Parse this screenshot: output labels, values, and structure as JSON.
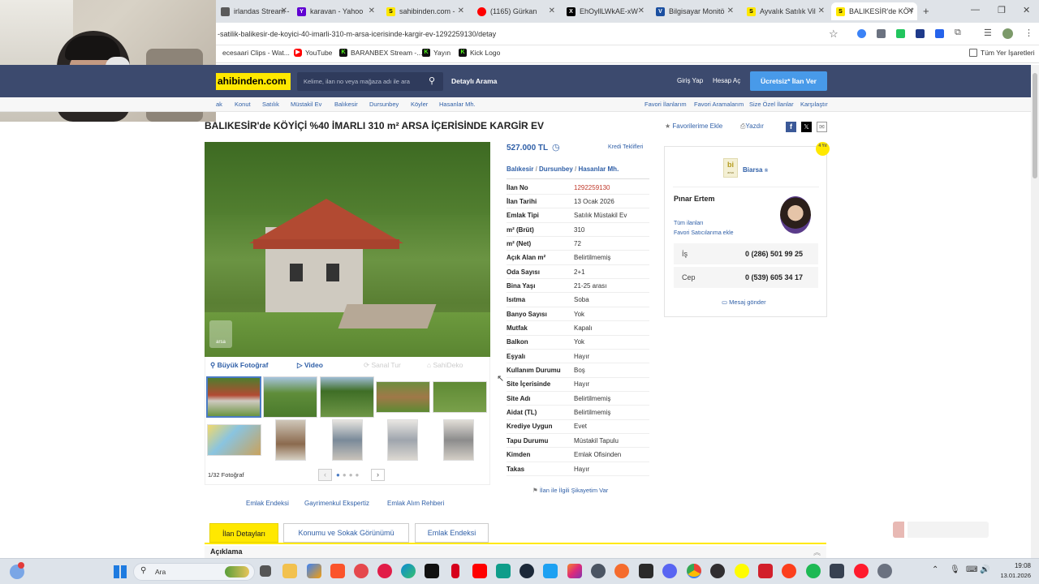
{
  "browser": {
    "tabs": [
      {
        "title": "irlandas Stream -",
        "fav_color": "#5a5a5a"
      },
      {
        "title": "karavan - Yahoo",
        "fav_color": "#6001d2",
        "fav": "Y"
      },
      {
        "title": "sahibinden.com -",
        "fav_color": "#ffe800",
        "fav": "S"
      },
      {
        "title": "(1165) Gürkan",
        "fav_color": "#ff0000"
      },
      {
        "title": "EhOyllLWkAE-xW",
        "fav_color": "#000000",
        "fav": "X"
      },
      {
        "title": "Bilgisayar Monitö",
        "fav_color": "#1b4fa0",
        "fav": "V"
      },
      {
        "title": "Ayvalık Satılık Vil",
        "fav_color": "#ffe800",
        "fav": "S"
      },
      {
        "title": "BALIKESİR'de KÖY",
        "fav_color": "#ffe800",
        "fav": "S"
      }
    ],
    "url": "-satilik-balikesir-de-koyici-40-imarli-310-m-arsa-icerisinde-kargir-ev-1292259130/detay",
    "bookmarks": [
      {
        "label": "ecesaari Clips - Wat..."
      },
      {
        "label": "YouTube"
      },
      {
        "label": "BARANBEX Stream -..."
      },
      {
        "label": "Yayın"
      },
      {
        "label": "Kick Logo"
      }
    ],
    "all_bookmarks": "Tüm Yer İşaretleri"
  },
  "site": {
    "logo": "ahibinden.com",
    "search_placeholder": "Kelime, ilan no veya mağaza adı ile ara",
    "detailed_search": "Detaylı Arama",
    "login": "Giriş Yap",
    "register": "Hesap Aç",
    "post_ad": "Ücretsiz* İlan Ver",
    "breadcrumbs": [
      "ak",
      "Konut",
      "Satılık",
      "Müstakil Ev",
      "Balıkesir",
      "Dursunbey",
      "Köyler",
      "Hasanlar Mh."
    ],
    "right_links": [
      "Favori İlanlarım",
      "Favori Aramalarım",
      "Size Özel İlanlar",
      "Karşılaştır"
    ]
  },
  "listing": {
    "title": "BALIKESİR'de KÖYİÇİ %40 İMARLI 310 m² ARSA İÇERİSİNDE KARGİR EV",
    "favorite": "Favorilerime Ekle",
    "print": "Yazdır",
    "price": "527.000 TL",
    "loan_offers": "Kredi Teklifleri",
    "location": [
      "Balıkesir",
      "Dursunbey",
      "Hasanlar Mh."
    ],
    "photo_watermark": "arsa",
    "media": {
      "big_photo": "Büyük Fotoğraf",
      "video": "Video",
      "virtual_tour": "Sanal Tur",
      "sahibeko": "SahiDeko"
    },
    "photo_counter": "1/32 Fotoğraf",
    "attributes": [
      {
        "k": "İlan No",
        "v": "1292259130",
        "red": true
      },
      {
        "k": "İlan Tarihi",
        "v": "13 Ocak 2026"
      },
      {
        "k": "Emlak Tipi",
        "v": "Satılık Müstakil Ev"
      },
      {
        "k": "m² (Brüt)",
        "v": "310"
      },
      {
        "k": "m² (Net)",
        "v": "72"
      },
      {
        "k": "Açık Alan m²",
        "v": "Belirtilmemiş"
      },
      {
        "k": "Oda Sayısı",
        "v": "2+1"
      },
      {
        "k": "Bina Yaşı",
        "v": "21-25 arası"
      },
      {
        "k": "Isıtma",
        "v": "Soba"
      },
      {
        "k": "Banyo Sayısı",
        "v": "Yok"
      },
      {
        "k": "Mutfak",
        "v": "Kapalı"
      },
      {
        "k": "Balkon",
        "v": "Yok"
      },
      {
        "k": "Eşyalı",
        "v": "Hayır"
      },
      {
        "k": "Kullanım Durumu",
        "v": "Boş"
      },
      {
        "k": "Site İçerisinde",
        "v": "Hayır"
      },
      {
        "k": "Site Adı",
        "v": "Belirtilmemiş"
      },
      {
        "k": "Aidat (TL)",
        "v": "Belirtilmemiş"
      },
      {
        "k": "Krediye Uygun",
        "v": "Evet"
      },
      {
        "k": "Tapu Durumu",
        "v": "Müstakil Tapulu"
      },
      {
        "k": "Kimden",
        "v": "Emlak Ofisinden"
      },
      {
        "k": "Takas",
        "v": "Hayır"
      }
    ],
    "complaint": "İlan ile İlgili Şikayetim Var",
    "links": [
      "Emlak Endeksi",
      "Gayrimenkul Ekspertiz",
      "Emlak Alım Rehberi"
    ],
    "tabs": [
      "İlan Detayları",
      "Konumu ve Sokak Görünümü",
      "Emlak Endeksi"
    ],
    "section": "Açıklama"
  },
  "seller": {
    "store": "Biarsa",
    "store_logo": "bi",
    "store_logo_sub": "arsa",
    "name": "Pınar Ertem",
    "all_ads": "Tüm ilanları",
    "fav_seller": "Favori Satıcılarıma ekle",
    "phones": [
      {
        "label": "İş",
        "num": "0 (286) 501 99 25"
      },
      {
        "label": "Cep",
        "num": "0 (539) 605 34 17"
      }
    ],
    "message": "Mesaj gönder",
    "badge": "4 Yıl"
  },
  "taskbar": {
    "search": "Ara",
    "time": "19:08",
    "date": "13.01.2026"
  }
}
